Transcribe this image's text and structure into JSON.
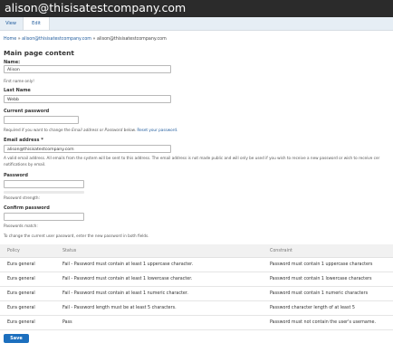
{
  "header": {
    "title": "alison@thisisatestcompany.com"
  },
  "tabs": {
    "view": "View",
    "edit": "Edit"
  },
  "breadcrumb": {
    "home": "Home",
    "sep1": "»",
    "user": "alison@thisisatestcompany.com",
    "sep2": "»",
    "current": "alison@thisisatestcompany.com"
  },
  "main": {
    "heading": "Main page content",
    "name": {
      "label": "Name:",
      "value": "Alison",
      "help": "First name only!"
    },
    "lastname": {
      "label": "Last Name",
      "value": "Webb"
    },
    "current_password": {
      "label": "Current password",
      "help_prefix": "Required if you want to change the ",
      "help_email": "Email address",
      "help_or": " or ",
      "help_password": "Password",
      "help_below": " below. ",
      "help_link": "Reset your password."
    },
    "email": {
      "label": "Email address *",
      "value": "alison@thisisatestcompany.com",
      "help_line1": "A valid email address. All emails from the system will be sent to this address. The email address is not made public and will only be used if you wish to receive a new password or wish to receive cer",
      "help_line2": "notifications by email."
    },
    "password": {
      "label": "Password",
      "strength": "Password strength:"
    },
    "confirm": {
      "label": "Confirm password",
      "match": "Passwords match:"
    },
    "change_note": "To change the current user password, enter the new password in both fields.",
    "table": {
      "headers": [
        "Policy",
        "Status",
        "Constraint"
      ],
      "rows": [
        {
          "policy": "Eura general",
          "status": "Fail - Password must contain at least 1 uppercase character.",
          "constraint": "Password must contain 1 uppercase characters"
        },
        {
          "policy": "Eura general",
          "status": "Fail - Password must contain at least 1 lowercase character.",
          "constraint": "Password must contain 1 lowercase characters"
        },
        {
          "policy": "Eura general",
          "status": "Fail - Password must contain at least 1 numeric character.",
          "constraint": "Password must contain 1 numeric characters"
        },
        {
          "policy": "Eura general",
          "status": "Fail - Password length must be at least 5 characters.",
          "constraint": "Password character length of at least 5"
        },
        {
          "policy": "Eura general",
          "status": "Pass",
          "constraint": "Password must not contain the user's username."
        }
      ]
    },
    "save": "Save"
  }
}
